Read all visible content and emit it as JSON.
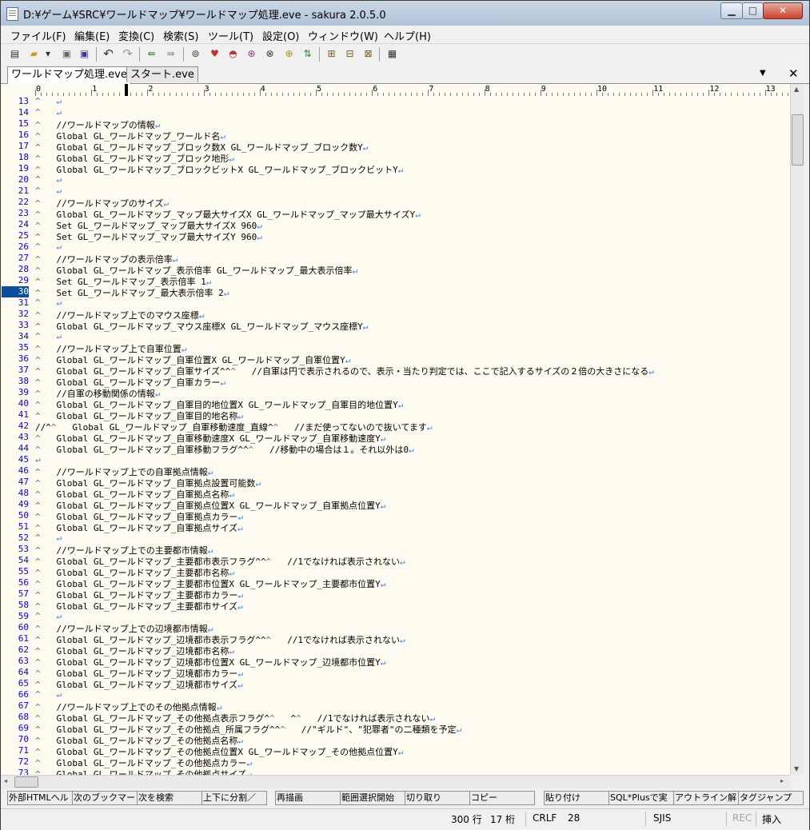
{
  "window": {
    "title": "D:¥ゲーム¥SRC¥ワールドマップ¥ワールドマップ処理.eve - sakura 2.0.5.0",
    "min_symbol": "▁",
    "max_symbol": "□",
    "close_symbol": "✕"
  },
  "menu": [
    "ファイル(F)",
    "編集(E)",
    "変換(C)",
    "検索(S)",
    "ツール(T)",
    "設定(O)",
    "ウィンドウ(W)",
    "ヘルプ(H)"
  ],
  "toolbar": [
    {
      "icon": "new-file-icon",
      "glyph": "▤"
    },
    {
      "icon": "open-folder-icon",
      "glyph": "▰"
    },
    {
      "icon": "dropdown-arrow-icon",
      "glyph": "▾"
    },
    {
      "icon": "save-icon",
      "glyph": "▣"
    },
    {
      "icon": "save-all-icon",
      "glyph": "▣"
    },
    {
      "icon": "undo-icon",
      "glyph": "↶"
    },
    {
      "icon": "redo-icon",
      "glyph": "↷"
    },
    {
      "icon": "jump-back-icon",
      "glyph": "⇚"
    },
    {
      "icon": "jump-forward-icon",
      "glyph": "⇛"
    },
    {
      "icon": "search-icon",
      "glyph": "⊚"
    },
    {
      "icon": "search-prev-icon",
      "glyph": "♥"
    },
    {
      "icon": "search-next-icon",
      "glyph": "◓"
    },
    {
      "icon": "grep-icon",
      "glyph": "⊛"
    },
    {
      "icon": "replace-icon",
      "glyph": "⊗"
    },
    {
      "icon": "bookmark-search-icon",
      "glyph": "⊕"
    },
    {
      "icon": "compare-icon",
      "glyph": "⇅"
    },
    {
      "icon": "tool-a-icon",
      "glyph": "⊞"
    },
    {
      "icon": "tool-b-icon",
      "glyph": "⊟"
    },
    {
      "icon": "tool-c-icon",
      "glyph": "⊠"
    },
    {
      "icon": "settings-icon",
      "glyph": "▦"
    }
  ],
  "tabs": [
    {
      "label": "ワールドマップ処理.eve",
      "active": true
    },
    {
      "label": "スタート.eve",
      "active": false
    }
  ],
  "tab_controls": {
    "dropdown": "▼",
    "close": "✕"
  },
  "ruler": [
    "0",
    "1",
    "2",
    "3",
    "4",
    "5",
    "6",
    "7",
    "8",
    "9",
    "10",
    "11",
    "12",
    "13"
  ],
  "editor": {
    "current_line": "30",
    "lines": [
      {
        "n": "13",
        "t": "\t↵"
      },
      {
        "n": "14",
        "t": "\t↵"
      },
      {
        "n": "15",
        "t": "\t//ワールドマップの情報↵"
      },
      {
        "n": "16",
        "t": "\tGlobal GL_ワールドマップ_ワールド名↵"
      },
      {
        "n": "17",
        "t": "\tGlobal GL_ワールドマップ_ブロック数X GL_ワールドマップ_ブロック数Y↵"
      },
      {
        "n": "18",
        "t": "\tGlobal GL_ワールドマップ_ブロック地形↵"
      },
      {
        "n": "19",
        "t": "\tGlobal GL_ワールドマップ_ブロックビットX GL_ワールドマップ_ブロックビットY↵"
      },
      {
        "n": "20",
        "t": "\t↵"
      },
      {
        "n": "21",
        "t": "\t↵"
      },
      {
        "n": "22",
        "t": "\t//ワールドマップのサイズ↵"
      },
      {
        "n": "23",
        "t": "\tGlobal GL_ワールドマップ_マップ最大サイズX GL_ワールドマップ_マップ最大サイズY↵"
      },
      {
        "n": "24",
        "t": "\tSet GL_ワールドマップ_マップ最大サイズX 960↵"
      },
      {
        "n": "25",
        "t": "\tSet GL_ワールドマップ_マップ最大サイズY 960↵"
      },
      {
        "n": "26",
        "t": "\t↵"
      },
      {
        "n": "27",
        "t": "\t//ワールドマップの表示倍率↵"
      },
      {
        "n": "28",
        "t": "\tGlobal GL_ワールドマップ_表示倍率 GL_ワールドマップ_最大表示倍率↵"
      },
      {
        "n": "29",
        "t": "\tSet GL_ワールドマップ_表示倍率 1↵"
      },
      {
        "n": "30",
        "t": "\tSet GL_ワールドマップ_最大表示倍率 2↵"
      },
      {
        "n": "31",
        "t": "\t↵"
      },
      {
        "n": "32",
        "t": "\t//ワールドマップ上でのマウス座標↵"
      },
      {
        "n": "33",
        "t": "\tGlobal GL_ワールドマップ_マウス座標X GL_ワールドマップ_マウス座標Y↵"
      },
      {
        "n": "34",
        "t": "\t↵"
      },
      {
        "n": "35",
        "t": "\t//ワールドマップ上で自軍位置↵"
      },
      {
        "n": "36",
        "t": "\tGlobal GL_ワールドマップ_自軍位置X GL_ワールドマップ_自軍位置Y↵"
      },
      {
        "n": "37",
        "t": "\tGlobal GL_ワールドマップ_自軍サイズ^^\t//自軍は円で表示されるので、表示・当たり判定では、ここで記入するサイズの２倍の大きさになる↵"
      },
      {
        "n": "38",
        "t": "\tGlobal GL_ワールドマップ_自軍カラー↵"
      },
      {
        "n": "39",
        "t": "\t//自軍の移動関係の情報↵"
      },
      {
        "n": "40",
        "t": "\tGlobal GL_ワールドマップ_自軍目的地位置X GL_ワールドマップ_自軍目的地位置Y↵"
      },
      {
        "n": "41",
        "t": "\tGlobal GL_ワールドマップ_自軍目的地名称↵"
      },
      {
        "n": "42",
        "t": "//^\tGlobal GL_ワールドマップ_自軍移動速度_直線^\t//まだ使ってないので抜いてます↵"
      },
      {
        "n": "43",
        "t": "\tGlobal GL_ワールドマップ_自軍移動速度X GL_ワールドマップ_自軍移動速度Y↵"
      },
      {
        "n": "44",
        "t": "\tGlobal GL_ワールドマップ_自軍移動フラグ^^\t//移動中の場合は１。それ以外は0↵"
      },
      {
        "n": "45",
        "t": "↵"
      },
      {
        "n": "46",
        "t": "\t//ワールドマップ上での自軍拠点情報↵"
      },
      {
        "n": "47",
        "t": "\tGlobal GL_ワールドマップ_自軍拠点設置可能数↵"
      },
      {
        "n": "48",
        "t": "\tGlobal GL_ワールドマップ_自軍拠点名称↵"
      },
      {
        "n": "49",
        "t": "\tGlobal GL_ワールドマップ_自軍拠点位置X GL_ワールドマップ_自軍拠点位置Y↵"
      },
      {
        "n": "50",
        "t": "\tGlobal GL_ワールドマップ_自軍拠点カラー↵"
      },
      {
        "n": "51",
        "t": "\tGlobal GL_ワールドマップ_自軍拠点サイズ↵"
      },
      {
        "n": "52",
        "t": "\t↵"
      },
      {
        "n": "53",
        "t": "\t//ワールドマップ上での主要都市情報↵"
      },
      {
        "n": "54",
        "t": "\tGlobal GL_ワールドマップ_主要都市表示フラグ^^\t//1でなければ表示されない↵"
      },
      {
        "n": "55",
        "t": "\tGlobal GL_ワールドマップ_主要都市名称↵"
      },
      {
        "n": "56",
        "t": "\tGlobal GL_ワールドマップ_主要都市位置X GL_ワールドマップ_主要都市位置Y↵"
      },
      {
        "n": "57",
        "t": "\tGlobal GL_ワールドマップ_主要都市カラー↵"
      },
      {
        "n": "58",
        "t": "\tGlobal GL_ワールドマップ_主要都市サイズ↵"
      },
      {
        "n": "59",
        "t": "\t↵"
      },
      {
        "n": "60",
        "t": "\t//ワールドマップ上での辺境都市情報↵"
      },
      {
        "n": "61",
        "t": "\tGlobal GL_ワールドマップ_辺境都市表示フラグ^^\t//1でなければ表示されない↵"
      },
      {
        "n": "62",
        "t": "\tGlobal GL_ワールドマップ_辺境都市名称↵"
      },
      {
        "n": "63",
        "t": "\tGlobal GL_ワールドマップ_辺境都市位置X GL_ワールドマップ_辺境都市位置Y↵"
      },
      {
        "n": "64",
        "t": "\tGlobal GL_ワールドマップ_辺境都市カラー↵"
      },
      {
        "n": "65",
        "t": "\tGlobal GL_ワールドマップ_辺境都市サイズ↵"
      },
      {
        "n": "66",
        "t": "\t↵"
      },
      {
        "n": "67",
        "t": "\t//ワールドマップ上でのその他拠点情報↵"
      },
      {
        "n": "68",
        "t": "\tGlobal GL_ワールドマップ_その他拠点表示フラグ^\t^\t//1でなければ表示されない↵"
      },
      {
        "n": "69",
        "t": "\tGlobal GL_ワールドマップ_その他拠点_所属フラグ^^\t//\"ギルド\"、\"犯罪者\"の二種類を予定↵"
      },
      {
        "n": "70",
        "t": "\tGlobal GL_ワールドマップ_その他拠点名称↵"
      },
      {
        "n": "71",
        "t": "\tGlobal GL_ワールドマップ_その他拠点位置X GL_ワールドマップ_その他拠点位置Y↵"
      },
      {
        "n": "72",
        "t": "\tGlobal GL_ワールドマップ_その他拠点カラー↵"
      },
      {
        "n": "73",
        "t": "\tGlobal GL_ワールドマップ_その他拠点サイズ↵"
      }
    ]
  },
  "scroll": {
    "up": "▲",
    "down": "▼",
    "left": "◂",
    "right": "▸"
  },
  "function_keys": [
    "外部HTMLヘル",
    "次のブックマー",
    "次を検索",
    "上下に分割／",
    "再描画",
    "範囲選択開始",
    "切り取り",
    "コピー",
    "貼り付け",
    "SQL*Plusで実",
    "アウトライン解",
    "タグジャンプ"
  ],
  "status": {
    "row": "300 行",
    "col": "17 桁",
    "eol": "CRLF",
    "code": "28",
    "charset": "SJIS",
    "rec": "REC",
    "mode": "挿入"
  }
}
